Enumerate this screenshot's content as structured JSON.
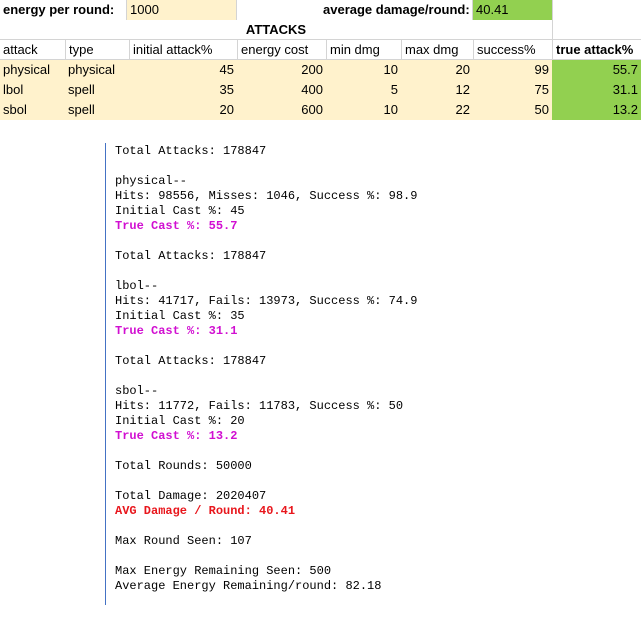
{
  "sheet": {
    "energy_label": "energy per round:",
    "energy_value": "1000",
    "avg_label": "average damage/round:",
    "avg_value": "40.41",
    "section_title": "ATTACKS",
    "headers": [
      "attack",
      "type",
      "initial attack%",
      "energy cost",
      "min dmg",
      "max dmg",
      "success%",
      "true attack%"
    ],
    "rows": [
      [
        "physical",
        "physical",
        "45",
        "200",
        "10",
        "20",
        "99",
        "55.7"
      ],
      [
        "lbol",
        "spell",
        "35",
        "400",
        "5",
        "12",
        "75",
        "31.1"
      ],
      [
        "sbol",
        "spell",
        "20",
        "600",
        "10",
        "22",
        "50",
        "13.2"
      ]
    ]
  },
  "console": {
    "total_attacks_1": "Total Attacks: 178847",
    "physical_title": "physical--",
    "physical_stats": "Hits: 98556, Misses: 1046, Success %: 98.9",
    "physical_initial": "Initial Cast %: 45",
    "physical_true": "True Cast %: 55.7",
    "total_attacks_2": "Total Attacks: 178847",
    "lbol_title": "lbol--",
    "lbol_stats": "Hits: 41717, Fails: 13973, Success %: 74.9",
    "lbol_initial": "Initial Cast %: 35",
    "lbol_true": "True Cast %: 31.1",
    "total_attacks_3": "Total Attacks: 178847",
    "sbol_title": "sbol--",
    "sbol_stats": "Hits: 11772, Fails: 11783, Success %: 50",
    "sbol_initial": "Initial Cast %: 20",
    "sbol_true": "True Cast %: 13.2",
    "total_rounds": "Total Rounds: 50000",
    "total_damage": "Total Damage: 2020407",
    "avg_damage": "AVG Damage / Round: 40.41",
    "max_round": "Max Round Seen: 107",
    "max_energy": "Max Energy Remaining Seen: 500",
    "avg_energy": "Average Energy Remaining/round: 82.18"
  },
  "colors": {
    "cream": "#fff2cc",
    "green": "#92d050",
    "magenta": "#d10fd1",
    "red": "#e8161c",
    "console_rule": "#4472c4"
  }
}
